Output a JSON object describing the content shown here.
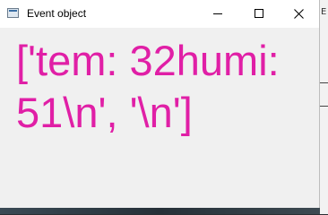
{
  "window": {
    "title": "Event object",
    "icon": "app-window-icon",
    "controls": {
      "minimize_icon": "minimize-icon",
      "maximize_icon": "maximize-icon",
      "close_icon": "close-icon"
    }
  },
  "content": {
    "output_line_1": "['tem: 32humi:",
    "output_line_2": "51\\n', '\\n']",
    "text_color": "#e01fa6"
  },
  "background_window": {
    "partial_glyph": "E"
  }
}
